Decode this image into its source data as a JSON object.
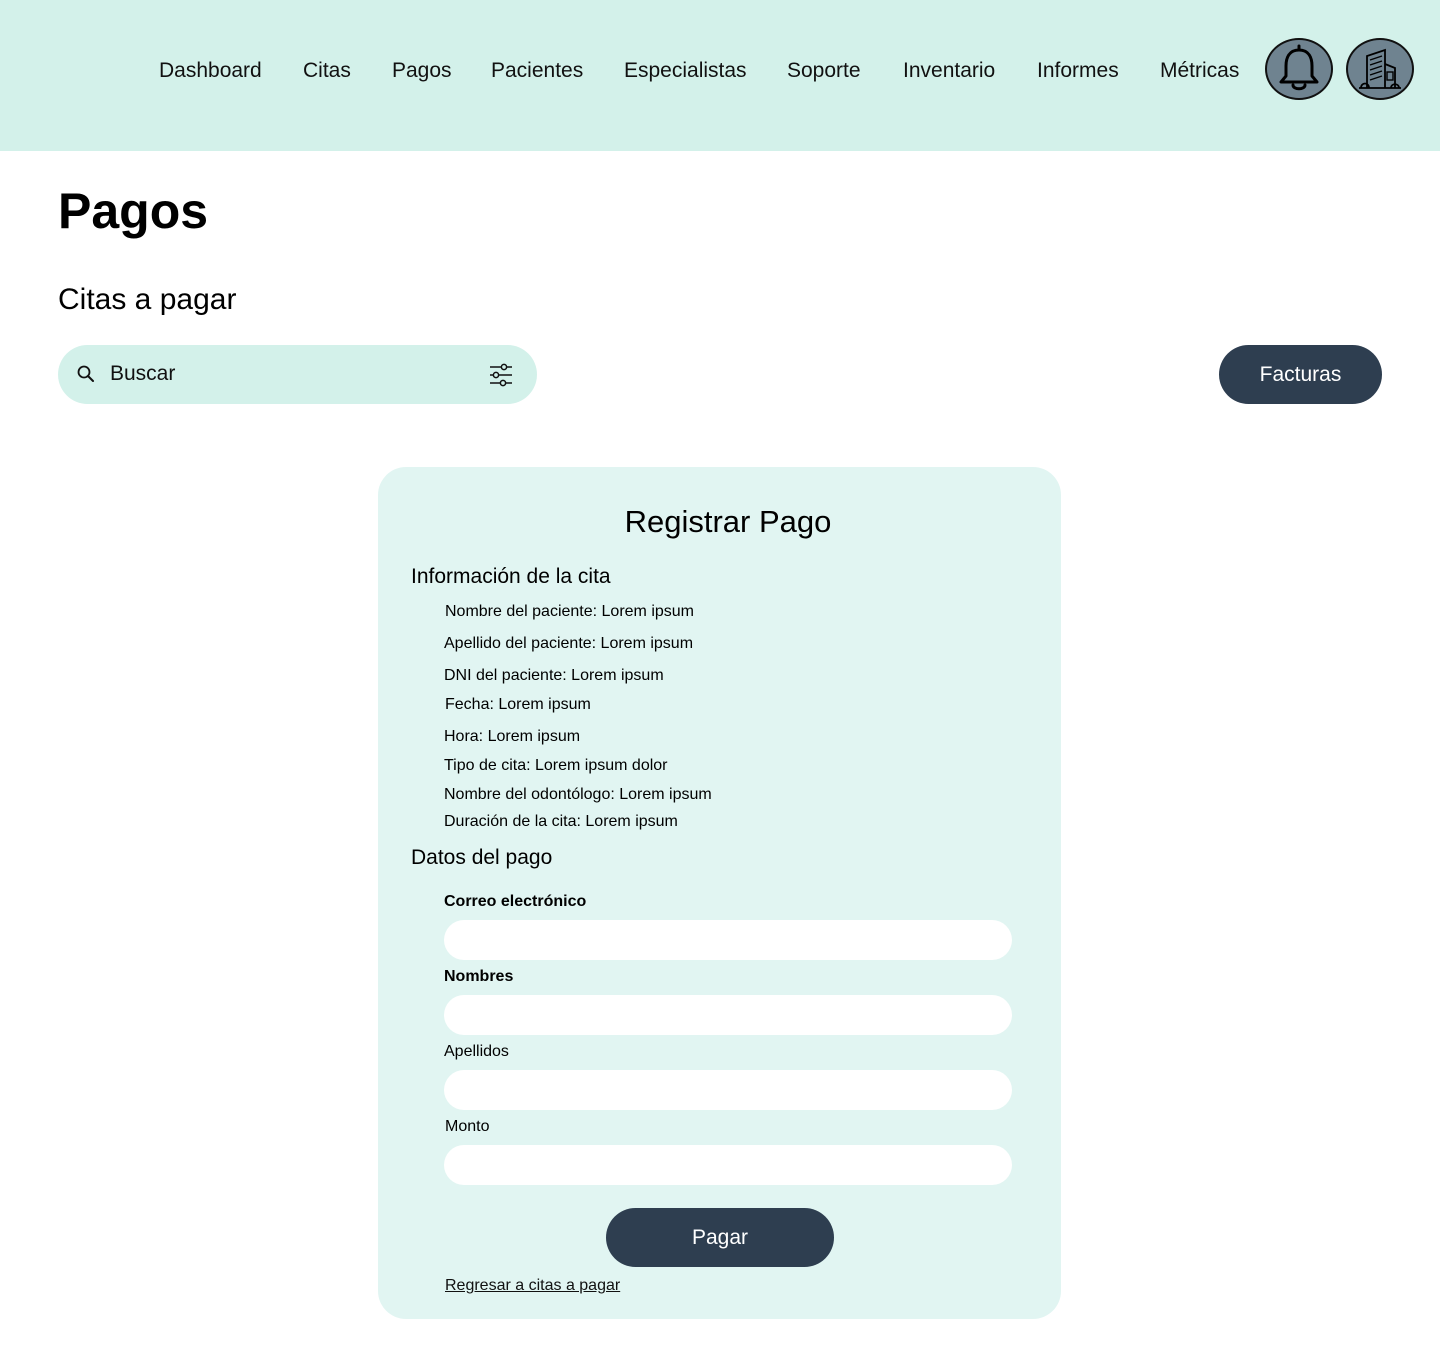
{
  "nav": {
    "items": [
      "Dashboard",
      "Citas",
      "Pagos",
      "Pacientes",
      "Especialistas",
      "Soporte",
      "Inventario",
      "Informes",
      "Métricas"
    ],
    "notification_icon": "bell-icon",
    "clinic_icon": "building-icon"
  },
  "page": {
    "title": "Pagos",
    "section_title": "Citas a pagar"
  },
  "search": {
    "placeholder": "Buscar",
    "icon": "search-icon",
    "filter_icon": "sliders-icon"
  },
  "facturas_label": "Facturas",
  "form": {
    "title": "Registrar Pago",
    "info_heading": "Información de la cita",
    "info_items": [
      "Nombre del paciente: Lorem ipsum",
      "Apellido del paciente: Lorem ipsum",
      "DNI del paciente: Lorem ipsum",
      "Fecha: Lorem ipsum",
      "Hora: Lorem ipsum",
      "Tipo de cita: Lorem ipsum dolor",
      "Nombre del odontólogo: Lorem ipsum",
      "Duración de la cita: Lorem ipsum"
    ],
    "payment_heading": "Datos del pago",
    "fields": [
      {
        "label": "Correo electrónico",
        "value": ""
      },
      {
        "label": "Nombres",
        "value": ""
      },
      {
        "label": "Apellidos",
        "value": ""
      },
      {
        "label": "Monto",
        "value": ""
      }
    ],
    "submit_label": "Pagar",
    "back_link": "Regresar a citas a pagar"
  },
  "colors": {
    "header_bg": "#d3f1ea",
    "card_bg": "#e1f5f2",
    "primary_button": "#2e3e50",
    "icon_button_bg": "#6f8390"
  }
}
